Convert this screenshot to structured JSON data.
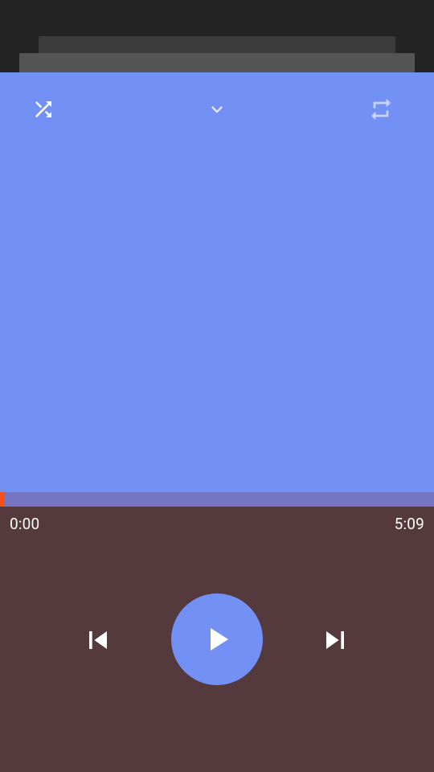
{
  "player": {
    "elapsed_time": "0:00",
    "total_time": "5:09",
    "progress_fraction": 0.01,
    "icons": {
      "shuffle": "shuffle-icon",
      "collapse": "chevron-down-icon",
      "repeat": "repeat-icon",
      "previous": "skip-previous-icon",
      "play": "play-icon",
      "next": "skip-next-icon"
    }
  },
  "colors": {
    "background": "#232323",
    "art_panel": "#7391f4",
    "progress_track": "#7575c4",
    "progress_fill": "#f4511e",
    "controls_panel": "#543a3c",
    "play_button": "#7391f4",
    "icon": "#ffffff"
  }
}
